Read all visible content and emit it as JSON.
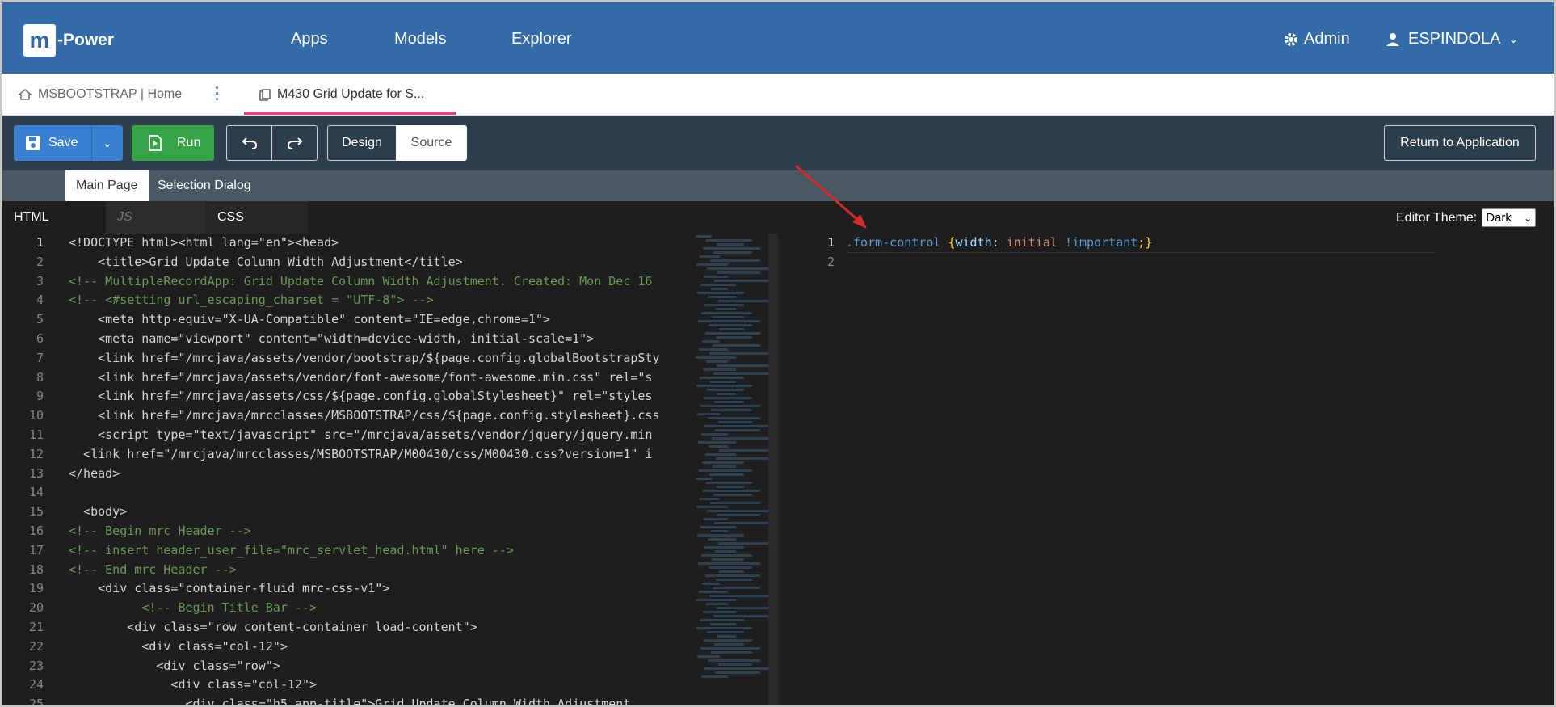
{
  "app": {
    "logo_letter": "m",
    "logo_text": "-Power"
  },
  "nav": {
    "apps": "Apps",
    "models": "Models",
    "explorer": "Explorer"
  },
  "header": {
    "admin": "Admin",
    "user": "ESPINDOLA"
  },
  "tabs": [
    {
      "label": "MSBOOTSTRAP | Home"
    },
    {
      "label": "M430 Grid Update for S..."
    }
  ],
  "toolbar": {
    "save": "Save",
    "run": "Run",
    "design": "Design",
    "source": "Source",
    "return": "Return to Application"
  },
  "page_tabs": [
    "Main Page",
    "Selection Dialog"
  ],
  "editor_tabs": {
    "html": "HTML",
    "js": "JS",
    "css": "CSS"
  },
  "editor_theme": {
    "label": "Editor Theme:",
    "value": "Dark"
  },
  "html_code": [
    "<!DOCTYPE html><html lang=\"en\"><head>",
    "    <title>Grid Update Column Width Adjustment</title>",
    "<!-- MultipleRecordApp: Grid Update Column Width Adjustment. Created: Mon Dec 16",
    "<!-- <#setting url_escaping_charset = \"UTF-8\"> -->",
    "    <meta http-equiv=\"X-UA-Compatible\" content=\"IE=edge,chrome=1\">",
    "    <meta name=\"viewport\" content=\"width=device-width, initial-scale=1\">",
    "    <link href=\"/mrcjava/assets/vendor/bootstrap/${page.config.globalBootstrapSty",
    "    <link href=\"/mrcjava/assets/vendor/font-awesome/font-awesome.min.css\" rel=\"s",
    "    <link href=\"/mrcjava/assets/css/${page.config.globalStylesheet}\" rel=\"styles",
    "    <link href=\"/mrcjava/mrcclasses/MSBOOTSTRAP/css/${page.config.stylesheet}.css",
    "    <script type=\"text/javascript\" src=\"/mrcjava/assets/vendor/jquery/jquery.min",
    "  <link href=\"/mrcjava/mrcclasses/MSBOOTSTRAP/M00430/css/M00430.css?version=1\" i",
    "</head>",
    "",
    "  <body>",
    "<!-- Begin mrc Header -->",
    "<!-- insert header_user_file=\"mrc_servlet_head.html\" here -->",
    "<!-- End mrc Header -->",
    "    <div class=\"container-fluid mrc-css-v1\">",
    "          <!-- Begin Title Bar -->",
    "        <div class=\"row content-container load-content\">",
    "          <div class=\"col-12\">",
    "            <div class=\"row\">",
    "              <div class=\"col-12\">",
    "                <div class=\"h5 app-title\">Grid Update Column Width Adjustment"
  ],
  "line_numbers": [
    "1",
    "2",
    "3",
    "4",
    "5",
    "6",
    "7",
    "8",
    "9",
    "10",
    "11",
    "12",
    "13",
    "14",
    "15",
    "16",
    "17",
    "18",
    "19",
    "20",
    "21",
    "22",
    "23",
    "24",
    "25"
  ],
  "css_line_numbers": [
    "1",
    "2"
  ],
  "css_code": {
    "selector": ".form-control",
    "open": "{",
    "prop": "width",
    "value": "initial",
    "important": "!important",
    "close": ";}"
  },
  "colors": {
    "topbar": "#336ba9",
    "accent_tab": "#e0457b",
    "save": "#3a81d1",
    "run": "#36a347",
    "editor_bg": "#1e1e1e"
  }
}
